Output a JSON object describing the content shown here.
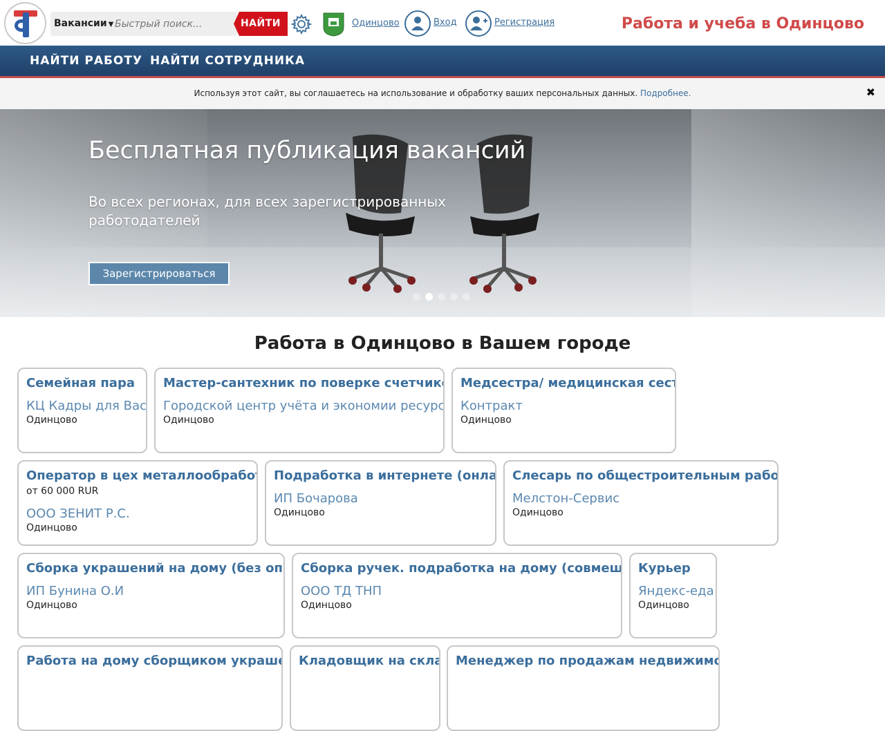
{
  "header": {
    "search_type": "Вакансии",
    "search_placeholder": "Быстрый поиск...",
    "search_button": "НАЙТИ",
    "city": "Одинцово",
    "login": "Вход",
    "register": "Регистрация",
    "site_title": "Работа и учеба в Одинцово"
  },
  "nav": {
    "find_job": "НАЙТИ РАБОТУ",
    "find_employee": "НАЙТИ СОТРУДНИКА"
  },
  "cookie": {
    "text": "Используя этот сайт, вы соглашаетесь на использование и обработку ваших персональных данных.",
    "link": "Подробнее.",
    "close": "✖"
  },
  "hero": {
    "title": "Бесплатная публикация вакансий",
    "subtitle": "Во всех регионах, для всех зарегистрированных работодателей",
    "button": "Зарегистрироваться",
    "slides": 5,
    "active_slide": 2
  },
  "jobs": {
    "section_title": "Работа в Одинцово в Вашем городе",
    "cards": [
      {
        "title": "Семейная пара",
        "company": "КЦ Кадры для Вас",
        "city": "Одинцово"
      },
      {
        "title": "Мастер-сантехник по поверке счетчиков",
        "company": "Городской центр учёта и экономии ресурсов",
        "city": "Одинцово"
      },
      {
        "title": "Медсестра/ медицинская сестра",
        "company": "Контракт",
        "city": "Одинцово"
      },
      {
        "title": "Оператор в цех металлообработки",
        "salary": "от 60 000 RUR",
        "company": "ООО ЗЕНИТ Р.С.",
        "city": "Одинцово"
      },
      {
        "title": "Подработка в интернете (онлайн)",
        "company": "ИП Бочарова",
        "city": "Одинцово"
      },
      {
        "title": "Слесарь по общестроительным работам",
        "company": "Мелстон-Сервис",
        "city": "Одинцово"
      },
      {
        "title": "Сборка украшений на дому (без опыта)",
        "company": "ИП Бунина О.И",
        "city": "Одинцово"
      },
      {
        "title": "Сборка ручек. подработка на дому (совмещение)",
        "company": "ООО ТД ТНП",
        "city": "Одинцово"
      },
      {
        "title": "Курьер",
        "company": "Яндекс-еда",
        "city": "Одинцово"
      },
      {
        "title": "Работа на дому сборщиком украшений",
        "company": "",
        "city": ""
      },
      {
        "title": "Кладовщик на склад",
        "company": "",
        "city": ""
      },
      {
        "title": "Менеджер по продажам недвижимости",
        "company": "",
        "city": ""
      }
    ]
  }
}
